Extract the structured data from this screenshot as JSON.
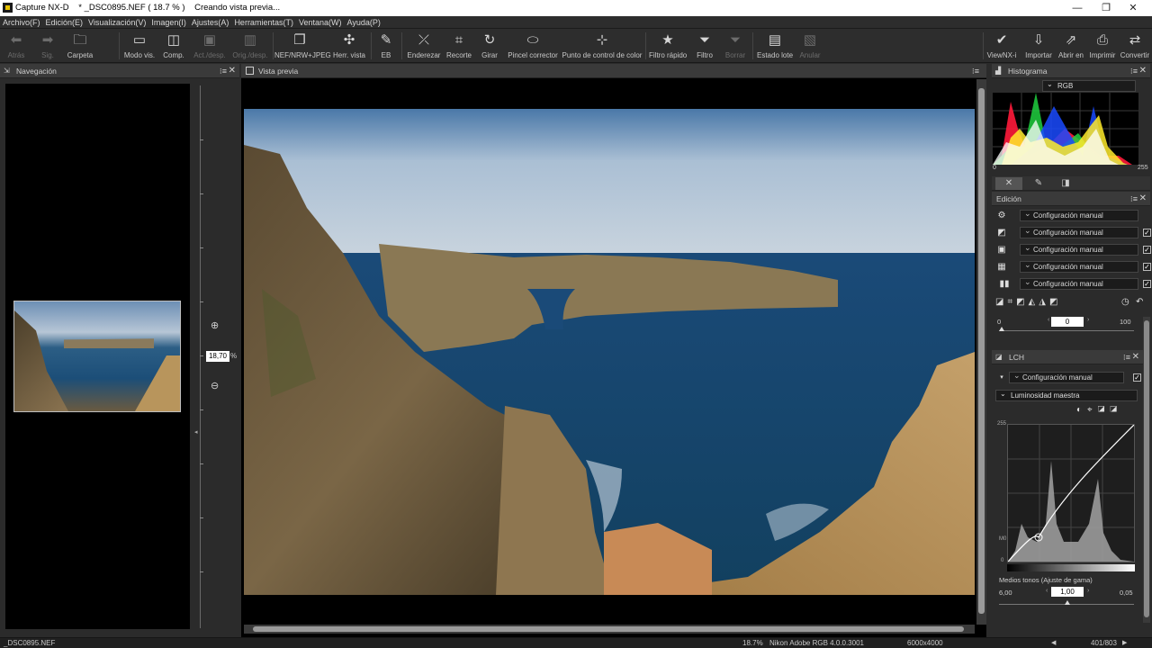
{
  "titlebar": {
    "app": "Capture NX-D",
    "file": "* _DSC0895.NEF ( 18.7 % )",
    "status": "Creando vista previa..."
  },
  "window_controls": {
    "minimize": "—",
    "maximize": "❐",
    "close": "✕"
  },
  "menu": [
    "Archivo(F)",
    "Edición(E)",
    "Visualización(V)",
    "Imagen(I)",
    "Ajustes(A)",
    "Herramientas(T)",
    "Ventana(W)",
    "Ayuda(P)"
  ],
  "toolbar": {
    "back": "Atrás",
    "forward": "Sig.",
    "folder": "Carpeta",
    "view_mode": "Modo vis.",
    "compare": "Comp.",
    "act_desp": "Act./desp.",
    "orig_desp": "Orig./desp.",
    "nef_jpeg": "NEF/NRW+JPEG",
    "view_tools": "Herr. vista",
    "eb": "EB",
    "straighten": "Enderezar",
    "crop": "Recorte",
    "rotate": "Girar",
    "retouch": "Pincel corrector",
    "color_control": "Punto de control de color",
    "quick_filter": "Filtro rápido",
    "filter": "Filtro",
    "clear": "Borrar",
    "batch_status": "Estado lote",
    "cancel": "Anular",
    "viewnx": "ViewNX-i",
    "import": "Importar",
    "open_with": "Abrir en",
    "print": "Imprimir",
    "convert": "Convertir"
  },
  "navigation": {
    "title": "Navegación",
    "zoom_value": "18,70",
    "zoom_unit": "%"
  },
  "preview": {
    "title": "Vista previa"
  },
  "histogram": {
    "title": "Histograma",
    "channel": "RGB",
    "min": "0",
    "max": "255"
  },
  "edit": {
    "title": "Edición",
    "rows": [
      "Configuración manual",
      "Configuración manual",
      "Configuración manual",
      "Configuración manual",
      "Configuración manual"
    ],
    "slider_min": "0",
    "slider_value": "0",
    "slider_max": "100"
  },
  "lch": {
    "title": "LCH",
    "preset": "Configuración manual",
    "channel": "Luminosidad maestra",
    "curve_top": "255",
    "curve_mid": "M0",
    "curve_bottom": "0",
    "midtones_label": "Medios tonos (Ajuste de gama)",
    "gamma_min": "6,00",
    "gamma_value": "1,00",
    "gamma_max": "0,05"
  },
  "status": {
    "filename": "_DSC0895.NEF",
    "zoom": "18.7%",
    "profile": "Nikon Adobe RGB 4.0.0.3001",
    "dimensions": "6000x4000",
    "page": "401/803"
  }
}
